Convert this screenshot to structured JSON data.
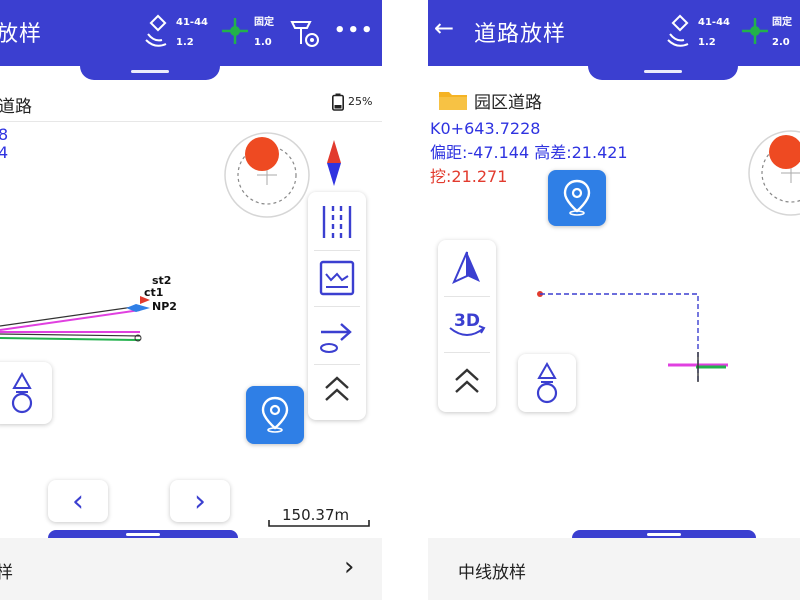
{
  "left_screen": {
    "header": {
      "title_partial": "放样",
      "sat_top": "41-44",
      "sat_bottom": "1.2",
      "fix_label": "固定",
      "fix_value": "1.0",
      "more": "•••"
    },
    "project": {
      "name_partial": "道路",
      "battery": "25%"
    },
    "info": {
      "line1": "8",
      "line2": "4"
    },
    "map_labels": {
      "st2": "st2",
      "ct1": "ct1",
      "np2": "NP2"
    },
    "scale": "150.37m",
    "bottom": {
      "label_partial": "样",
      "chevron": "›"
    },
    "nav": {
      "prev": "‹",
      "next": "›"
    }
  },
  "right_screen": {
    "header": {
      "back": "←",
      "title": "道路放样",
      "sat_top": "41-44",
      "sat_bottom": "1.2",
      "fix_label": "固定",
      "fix_value": "2.0"
    },
    "project": {
      "name": "园区道路"
    },
    "info": {
      "station": "K0+643.7228",
      "offset_elev": "偏距:-47.144 高差:21.421",
      "cut": "挖:21.271"
    },
    "tools": {
      "three_d": "3D"
    },
    "bottom": {
      "label": "中线放样"
    }
  },
  "colors": {
    "header_blue": "#3b3fd0",
    "info_blue": "#2f33e0",
    "cut_red": "#e23b2e",
    "action_blue": "#2f7fe6",
    "target_orange": "#ee4a22",
    "fix_green": "#22b14c"
  },
  "icons": {
    "satellite": "satellite-icon",
    "fix": "crosshair-fix-icon",
    "rtk": "gnss-receiver-icon",
    "more": "more-icon",
    "battery": "battery-icon",
    "compass": "compass-icon",
    "road_lines": "road-lines-icon",
    "profile": "profile-chart-icon",
    "stake_arrow": "stake-arrow-icon",
    "collapse": "chevron-up-double-icon",
    "location": "location-pin-icon",
    "person": "person-marker-icon",
    "north": "north-arrow-icon",
    "three_d": "3d-rotate-icon",
    "folder": "folder-icon",
    "back": "back-arrow-icon"
  }
}
